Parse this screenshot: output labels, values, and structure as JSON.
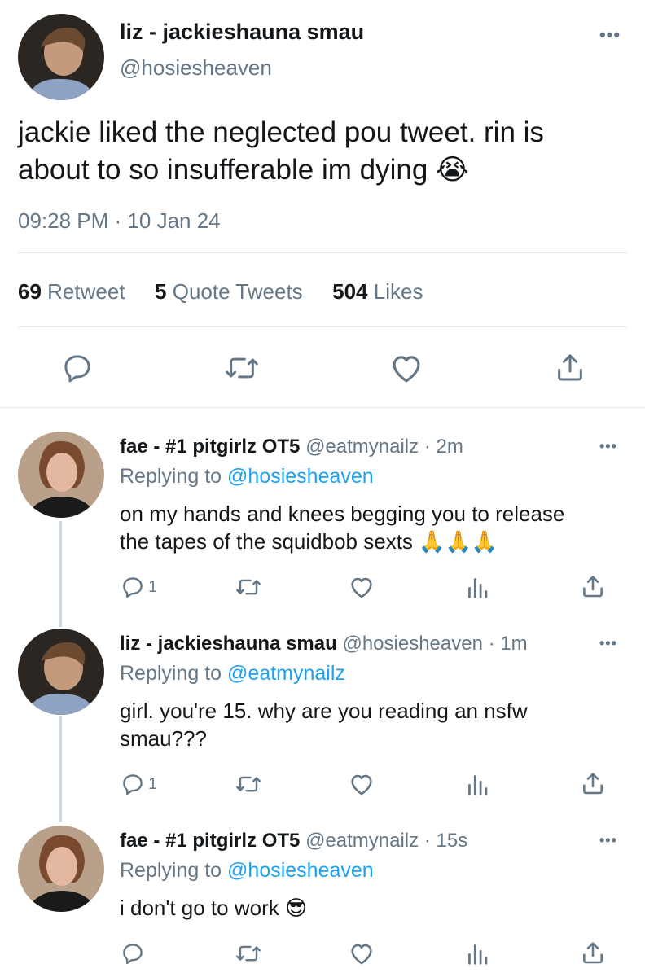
{
  "main_tweet": {
    "display_name": "liz - jackieshauna smau",
    "handle": "@hosiesheaven",
    "text": "jackie liked the neglected pou tweet. rin is about to so insufferable im dying",
    "emoji": "😭",
    "time": "09:28 PM",
    "separator": "·",
    "date": "10 Jan 24",
    "stats": {
      "retweets_count": "69",
      "retweets_label": "Retweet",
      "quotes_count": "5",
      "quotes_label": "Quote Tweets",
      "likes_count": "504",
      "likes_label": "Likes"
    },
    "more_icon": "more-horizontal-icon",
    "action_icons": [
      "reply-icon",
      "retweet-icon",
      "like-icon",
      "share-icon"
    ]
  },
  "replies": [
    {
      "display_name": "fae - #1 pitgirlz OT5",
      "handle": "@eatmynailz",
      "separator": "·",
      "time_ago": "2m",
      "replying_label": "Replying to",
      "replying_to": "@hosiesheaven",
      "text_line1": "on my hands and knees begging you to release",
      "text_line2": "the tapes of the squidbob sexts",
      "emoji": "🙏🙏🙏",
      "reply_count": "1"
    },
    {
      "display_name": "liz - jackieshauna smau",
      "handle": "@hosiesheaven",
      "separator": "·",
      "time_ago": "1m",
      "replying_label": "Replying to",
      "replying_to": "@eatmynailz",
      "text_line1": "girl. you're 15. why are you reading an nsfw",
      "text_line2": "smau???",
      "emoji": "",
      "reply_count": "1"
    },
    {
      "display_name": "fae - #1 pitgirlz OT5",
      "handle": "@eatmynailz",
      "separator": "·",
      "time_ago": "15s",
      "replying_label": "Replying to",
      "replying_to": "@hosiesheaven",
      "text_line1": "i don't go to work",
      "text_line2": "",
      "emoji": "😎",
      "reply_count": ""
    }
  ],
  "colors": {
    "link_blue": "#1da1f2",
    "secondary_grey": "#657786",
    "divider": "#e1e8ed"
  }
}
